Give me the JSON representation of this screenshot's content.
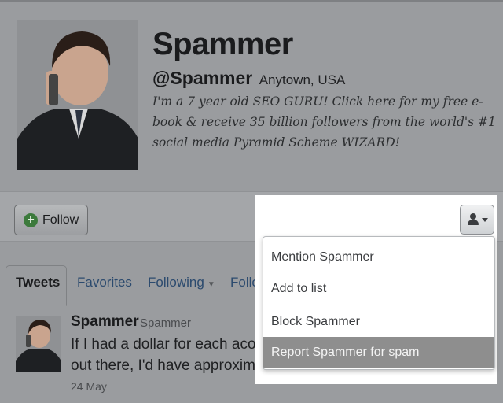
{
  "profile": {
    "name": "Spammer",
    "handle": "@Spammer",
    "location": "Anytown, USA",
    "bio": "I'm a 7 year old SEO GURU! Click here for my free e-book & receive 35 billion followers from the world's #1 social media Pyramid Scheme WIZARD!",
    "avatar_icon": "child-on-phone-photo"
  },
  "actions": {
    "follow_label": "Follow",
    "follow_icon": "plus-circle-icon",
    "user_menu_icon": "person-icon"
  },
  "dropdown": {
    "items": [
      {
        "label": "Mention Spammer"
      },
      {
        "label": "Add to list"
      },
      {
        "label": "Block Spammer"
      },
      {
        "label": "Report Spammer for spam",
        "highlighted": true
      }
    ]
  },
  "tabs": [
    {
      "label": "Tweets",
      "active": true
    },
    {
      "label": "Favorites"
    },
    {
      "label": "Following"
    },
    {
      "label": "Follow"
    }
  ],
  "tweet": {
    "name": "Spammer",
    "handle": "Spammer",
    "text_line1": "If I had a dollar for each acous",
    "text_line2": "out there, I'd have approximat",
    "date": "24 May"
  },
  "colors": {
    "overlay": "#9a9c9f",
    "menu_highlight": "#8e8e8e",
    "link": "#2b4a6e",
    "follow_green": "#3c7a3c"
  }
}
